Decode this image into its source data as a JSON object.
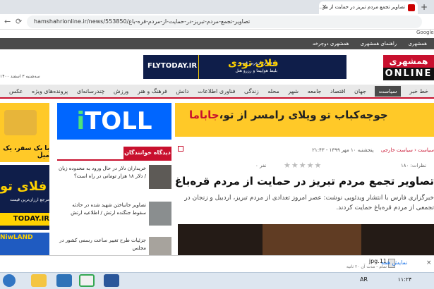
{
  "browser": {
    "tab_title": "تصاویر تجمع مردم تبریز در حمایت از مر...",
    "tab_close": "×",
    "new_tab": "+",
    "url": "hamshahrionline.ir/news/553850/تصاویر-تجمع-مردم-تبریز-در-حمایت-از-مردم-قره-باغ",
    "bookmark_google": "Google"
  },
  "site": {
    "top_links": [
      "همشهری",
      "راهنمای همشهری",
      "همشهری دوچرخه"
    ],
    "logo_top": "همشهری",
    "logo_bottom": "ONLINE",
    "date_text": "سه‌شنبه ۳ اسفند ۱۴۰۰",
    "fly_banner": {
      "brand_fa": "فلای تودی",
      "brand_en": "FLYTODAY.IR",
      "slogan1": "مرجع ارزان‌ترین قیمت",
      "slogan2": "بلیط هواپیما و رزرو هتل"
    },
    "nav": [
      "خط خبر",
      "سیاست",
      "جهان",
      "اقتصاد",
      "جامعه",
      "شهر",
      "محله",
      "زندگی",
      "فناوری اطلاعات",
      "دانش",
      "فرهنگ و هنر",
      "ورزش",
      "چندرسانه‌ای",
      "پرونده‌های ویژه",
      "عکس"
    ],
    "nav_active": "سیاست"
  },
  "banners": {
    "jabama_text": "جوجه‌کباب تو ویلای رامسر از تو،",
    "jabama_brand": "جاباما",
    "toll_text": "TOLL",
    "left_ad_text": "با یک سفر، یک میل",
    "left_ad_fa": "فلای تو",
    "left_ad_slogan": "مرجع ارزان‌ترین قیمت",
    "left_ad_site": "TODAY.IR",
    "left_ad_bottom": "NiwLAND"
  },
  "article": {
    "breadcrumb_date": "پنجشنبه ۱۰ مهر ۱۳۹۹ - ۲۱:۴۳",
    "breadcrumb": [
      "سیاست",
      "سیاست خارجی"
    ],
    "views": "نظرات: ۱۸۰",
    "votes": "۰ نفر",
    "rating": "★★★★★",
    "headline": "تصاویر تجمع مردم تبریز در حمایت از مردم قره‌باغ",
    "lead": "خبرگزاری فارس با انتشار ویدئویی نوشت: عصر امروز تعدادی از مردم تبریز، اردبیل و زنجان در تجمعی از مردم قره‌باغ حمایت کردند."
  },
  "readers": {
    "heading": "دیدگاه خوانندگان",
    "items": [
      {
        "text": "خریداران دلار در حال ورود به محدوده زیان / دلار ۱۸ هزار تومانی در راه است؟"
      },
      {
        "text": "تصاویر جانباختن شهید شده در حادثه سقوط جنگنده ارتش / اطلاعیه ارتش"
      },
      {
        "text": "جزئیات طرح تغییر ساعت رسمی کشور در مجلس"
      }
    ]
  },
  "download": {
    "file": "11.jpg",
    "status": "تمام - مدت آن ۲۰ ثانیه",
    "show_all": "نمایش همه",
    "close": "×"
  },
  "tray": {
    "lang": "AR",
    "time": "۱۱:۲۴"
  }
}
